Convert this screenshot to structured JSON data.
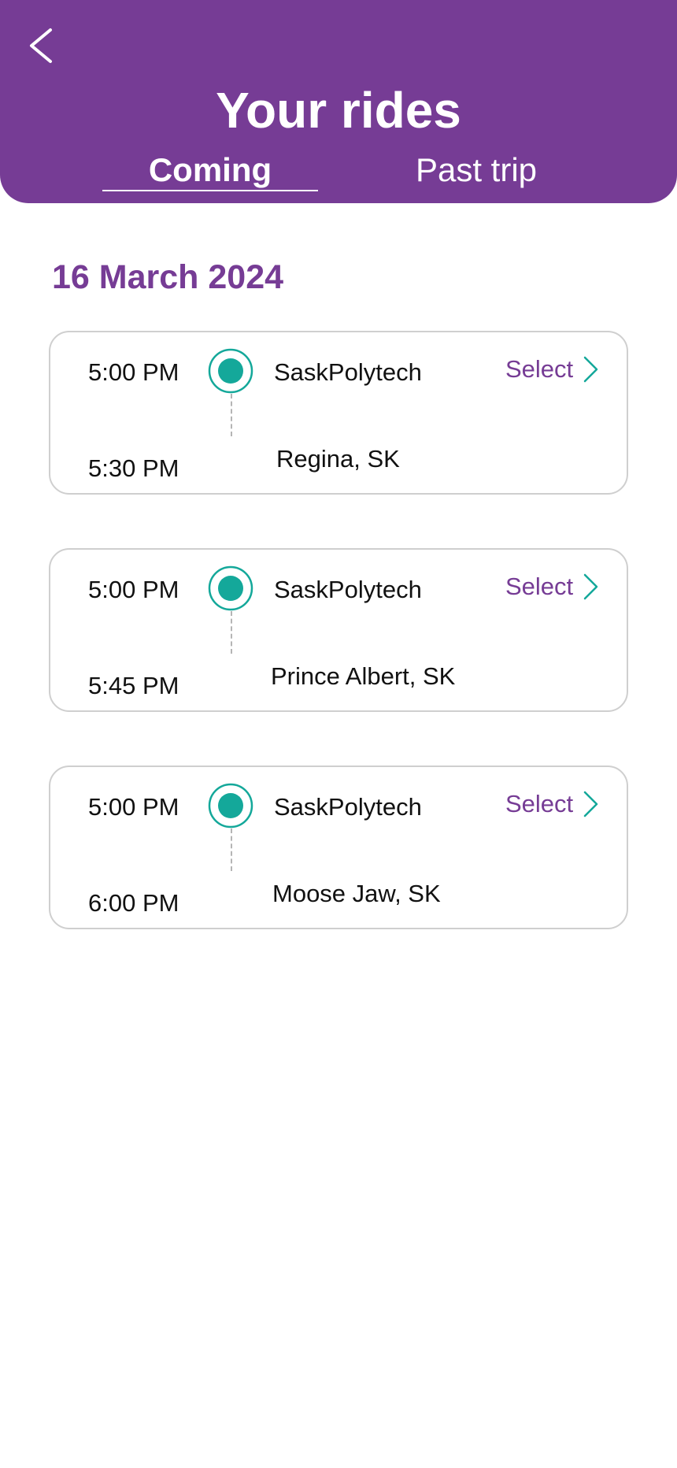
{
  "header": {
    "title": "Your rides",
    "tabs": [
      {
        "label": "Coming",
        "active": true
      },
      {
        "label": "Past trip",
        "active": false
      }
    ]
  },
  "date_heading": "16 March 2024",
  "rides": [
    {
      "depart_time": "5:00 PM",
      "arrive_time": "5:30 PM",
      "from": "SaskPolytech",
      "to": "Regina, SK",
      "action": "Select"
    },
    {
      "depart_time": "5:00 PM",
      "arrive_time": "5:45 PM",
      "from": "SaskPolytech",
      "to": "Prince Albert, SK",
      "action": "Select"
    },
    {
      "depart_time": "5:00 PM",
      "arrive_time": "6:00 PM",
      "from": "SaskPolytech",
      "to": "Moose Jaw, SK",
      "action": "Select"
    }
  ],
  "icons": {
    "back": "chevron-left-icon",
    "origin": "location-dot-icon",
    "select": "chevron-right-icon"
  },
  "colors": {
    "brand": "#763c95",
    "accent": "#14a89a",
    "card_border": "#cfcfcf"
  }
}
